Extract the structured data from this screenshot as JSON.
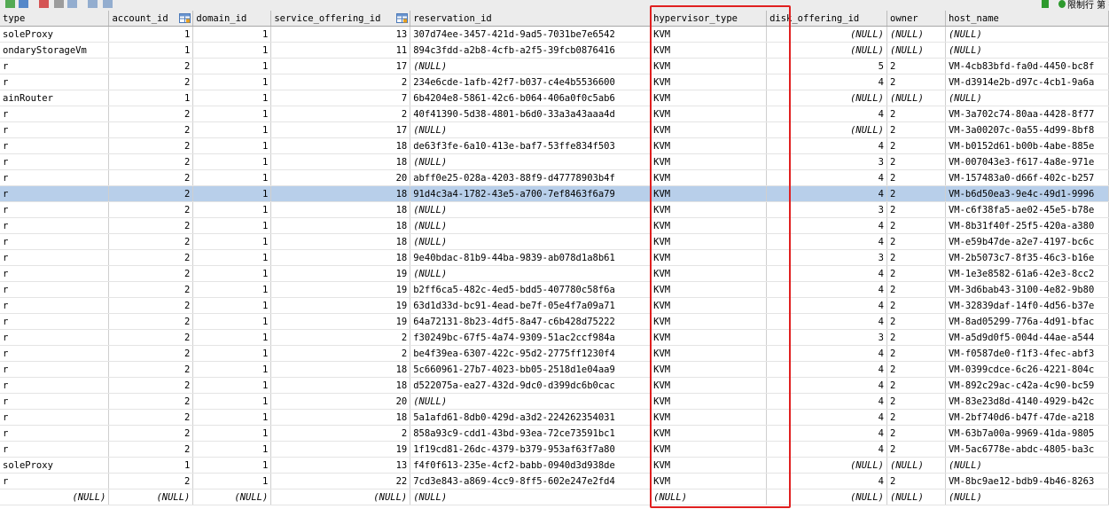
{
  "null_text": "(NULL)",
  "toolbar": {
    "left_icons": [
      "add-row-icon",
      "save-icon",
      "delete-row-icon",
      "discard-icon",
      "grid-view-icon",
      "form-view-icon",
      "text-view-icon"
    ],
    "right_icons": [
      "green-arrow-icon",
      "refresh-icon"
    ],
    "right_text": "限制行 第 行"
  },
  "columns": [
    {
      "key": "type",
      "label": "type",
      "align": "left",
      "sort_icon": false
    },
    {
      "key": "account_id",
      "label": "account_id",
      "align": "right",
      "sort_icon": true
    },
    {
      "key": "domain_id",
      "label": "domain_id",
      "align": "right",
      "sort_icon": false
    },
    {
      "key": "service_offering_id",
      "label": "service_offering_id",
      "align": "right",
      "sort_icon": true
    },
    {
      "key": "reservation_id",
      "label": "reservation_id",
      "align": "left",
      "sort_icon": false
    },
    {
      "key": "hypervisor_type",
      "label": "hypervisor_type",
      "align": "left",
      "sort_icon": false
    },
    {
      "key": "disk_offering_id",
      "label": "disk_offering_id",
      "align": "right",
      "sort_icon": false
    },
    {
      "key": "owner",
      "label": "owner",
      "align": "left",
      "sort_icon": false
    },
    {
      "key": "host_name",
      "label": "host_name",
      "align": "left",
      "sort_icon": false
    }
  ],
  "selected_row": 10,
  "highlight_column": "hypervisor_type",
  "rows": [
    [
      "soleProxy",
      "1",
      "1",
      "13",
      "307d74ee-3457-421d-9ad5-7031be7e6542",
      "KVM",
      null,
      null,
      null
    ],
    [
      "ondaryStorageVm",
      "1",
      "1",
      "11",
      "894c3fdd-a2b8-4cfb-a2f5-39fcb0876416",
      "KVM",
      null,
      null,
      null
    ],
    [
      "r",
      "2",
      "1",
      "17",
      null,
      "KVM",
      "5",
      "2",
      "VM-4cb83bfd-fa0d-4450-bc8f"
    ],
    [
      "r",
      "2",
      "1",
      "2",
      "234e6cde-1afb-42f7-b037-c4e4b5536600",
      "KVM",
      "4",
      "2",
      "VM-d3914e2b-d97c-4cb1-9a6a"
    ],
    [
      "ainRouter",
      "1",
      "1",
      "7",
      "6b4204e8-5861-42c6-b064-406a0f0c5ab6",
      "KVM",
      null,
      null,
      null
    ],
    [
      "r",
      "2",
      "1",
      "2",
      "40f41390-5d38-4801-b6d0-33a3a43aaa4d",
      "KVM",
      "4",
      "2",
      "VM-3a702c74-80aa-4428-8f77"
    ],
    [
      "r",
      "2",
      "1",
      "17",
      null,
      "KVM",
      null,
      "2",
      "VM-3a00207c-0a55-4d99-8bf8"
    ],
    [
      "r",
      "2",
      "1",
      "18",
      "de63f3fe-6a10-413e-baf7-53ffe834f503",
      "KVM",
      "4",
      "2",
      "VM-b0152d61-b00b-4abe-885e"
    ],
    [
      "r",
      "2",
      "1",
      "18",
      null,
      "KVM",
      "3",
      "2",
      "VM-007043e3-f617-4a8e-971e"
    ],
    [
      "r",
      "2",
      "1",
      "20",
      "abff0e25-028a-4203-88f9-d47778903b4f",
      "KVM",
      "4",
      "2",
      "VM-157483a0-d66f-402c-b257"
    ],
    [
      "r",
      "2",
      "1",
      "18",
      "91d4c3a4-1782-43e5-a700-7ef8463f6a79",
      "KVM",
      "4",
      "2",
      "VM-b6d50ea3-9e4c-49d1-9996"
    ],
    [
      "r",
      "2",
      "1",
      "18",
      null,
      "KVM",
      "3",
      "2",
      "VM-c6f38fa5-ae02-45e5-b78e"
    ],
    [
      "r",
      "2",
      "1",
      "18",
      null,
      "KVM",
      "4",
      "2",
      "VM-8b31f40f-25f5-420a-a380"
    ],
    [
      "r",
      "2",
      "1",
      "18",
      null,
      "KVM",
      "4",
      "2",
      "VM-e59b47de-a2e7-4197-bc6c"
    ],
    [
      "r",
      "2",
      "1",
      "18",
      "9e40bdac-81b9-44ba-9839-ab078d1a8b61",
      "KVM",
      "3",
      "2",
      "VM-2b5073c7-8f35-46c3-b16e"
    ],
    [
      "r",
      "2",
      "1",
      "19",
      null,
      "KVM",
      "4",
      "2",
      "VM-1e3e8582-61a6-42e3-8cc2"
    ],
    [
      "r",
      "2",
      "1",
      "19",
      "b2ff6ca5-482c-4ed5-bdd5-407780c58f6a",
      "KVM",
      "4",
      "2",
      "VM-3d6bab43-3100-4e82-9b80"
    ],
    [
      "r",
      "2",
      "1",
      "19",
      "63d1d33d-bc91-4ead-be7f-05e4f7a09a71",
      "KVM",
      "4",
      "2",
      "VM-32839daf-14f0-4d56-b37e"
    ],
    [
      "r",
      "2",
      "1",
      "19",
      "64a72131-8b23-4df5-8a47-c6b428d75222",
      "KVM",
      "4",
      "2",
      "VM-8ad05299-776a-4d91-bfac"
    ],
    [
      "r",
      "2",
      "1",
      "2",
      "f30249bc-67f5-4a74-9309-51ac2ccf984a",
      "KVM",
      "3",
      "2",
      "VM-a5d9d0f5-004d-44ae-a544"
    ],
    [
      "r",
      "2",
      "1",
      "2",
      "be4f39ea-6307-422c-95d2-2775ff1230f4",
      "KVM",
      "4",
      "2",
      "VM-f0587de0-f1f3-4fec-abf3"
    ],
    [
      "r",
      "2",
      "1",
      "18",
      "5c660961-27b7-4023-bb05-2518d1e04aa9",
      "KVM",
      "4",
      "2",
      "VM-0399cdce-6c26-4221-804c"
    ],
    [
      "r",
      "2",
      "1",
      "18",
      "d522075a-ea27-432d-9dc0-d399dc6b0cac",
      "KVM",
      "4",
      "2",
      "VM-892c29ac-c42a-4c90-bc59"
    ],
    [
      "r",
      "2",
      "1",
      "20",
      null,
      "KVM",
      "4",
      "2",
      "VM-83e23d8d-4140-4929-b42c"
    ],
    [
      "r",
      "2",
      "1",
      "18",
      "5a1afd61-8db0-429d-a3d2-224262354031",
      "KVM",
      "4",
      "2",
      "VM-2bf740d6-b47f-47de-a218"
    ],
    [
      "r",
      "2",
      "1",
      "2",
      "858a93c9-cdd1-43bd-93ea-72ce73591bc1",
      "KVM",
      "4",
      "2",
      "VM-63b7a00a-9969-41da-9805"
    ],
    [
      "r",
      "2",
      "1",
      "19",
      "1f19cd81-26dc-4379-b379-953af63f7a80",
      "KVM",
      "4",
      "2",
      "VM-5ac6778e-abdc-4805-ba3c"
    ],
    [
      "soleProxy",
      "1",
      "1",
      "13",
      "f4f0f613-235e-4cf2-babb-0940d3d938de",
      "KVM",
      null,
      null,
      null
    ],
    [
      "r",
      "2",
      "1",
      "22",
      "7cd3e843-a869-4cc9-8ff5-602e247e2fd4",
      "KVM",
      "4",
      "2",
      "VM-8bc9ae12-bdb9-4b46-8263"
    ],
    [
      null,
      null,
      null,
      null,
      null,
      null,
      null,
      null,
      null
    ]
  ]
}
